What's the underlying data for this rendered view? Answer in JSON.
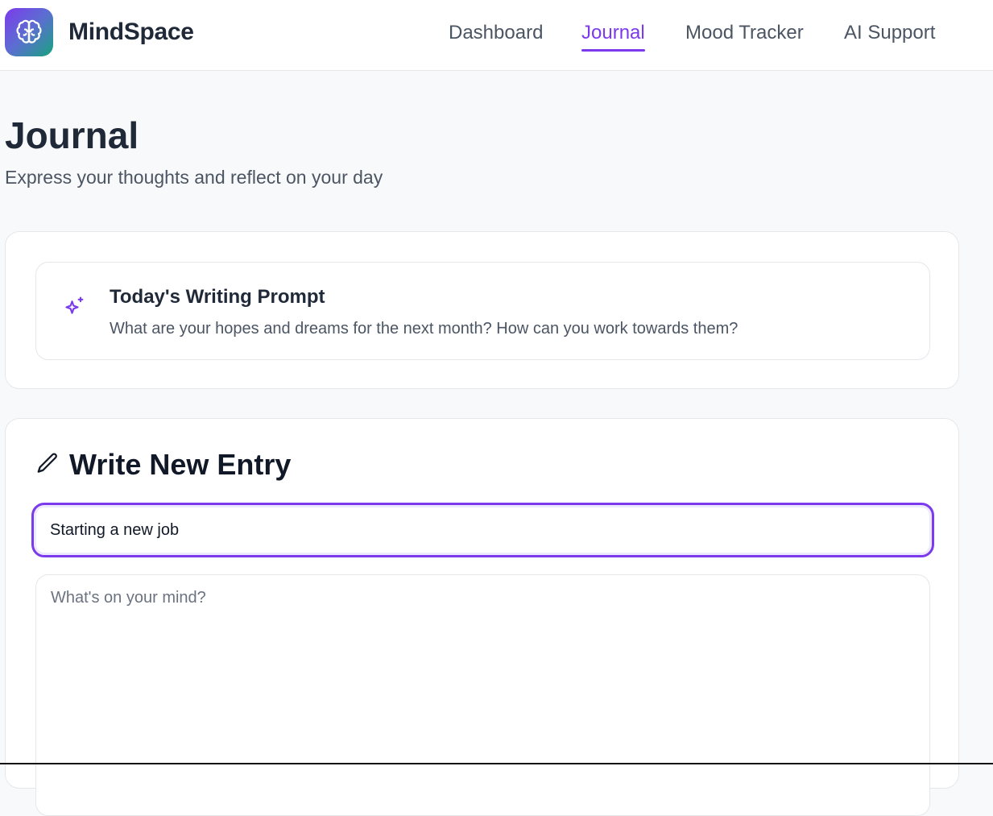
{
  "app": {
    "name": "MindSpace",
    "logo_icon": "brain-icon",
    "accent_color": "#7c3aed"
  },
  "nav": {
    "items": [
      {
        "label": "Dashboard",
        "active": false
      },
      {
        "label": "Journal",
        "active": true
      },
      {
        "label": "Mood Tracker",
        "active": false
      },
      {
        "label": "AI Support",
        "active": false
      }
    ]
  },
  "page": {
    "title": "Journal",
    "subtitle": "Express your thoughts and reflect on your day"
  },
  "prompt": {
    "icon": "sparkles-icon",
    "title": "Today's Writing Prompt",
    "text": "What are your hopes and dreams for the next month? How can you work towards them?"
  },
  "entry": {
    "icon": "pencil-icon",
    "heading": "Write New Entry",
    "title_value": "Starting a new job",
    "body_placeholder": "What's on your mind?"
  }
}
